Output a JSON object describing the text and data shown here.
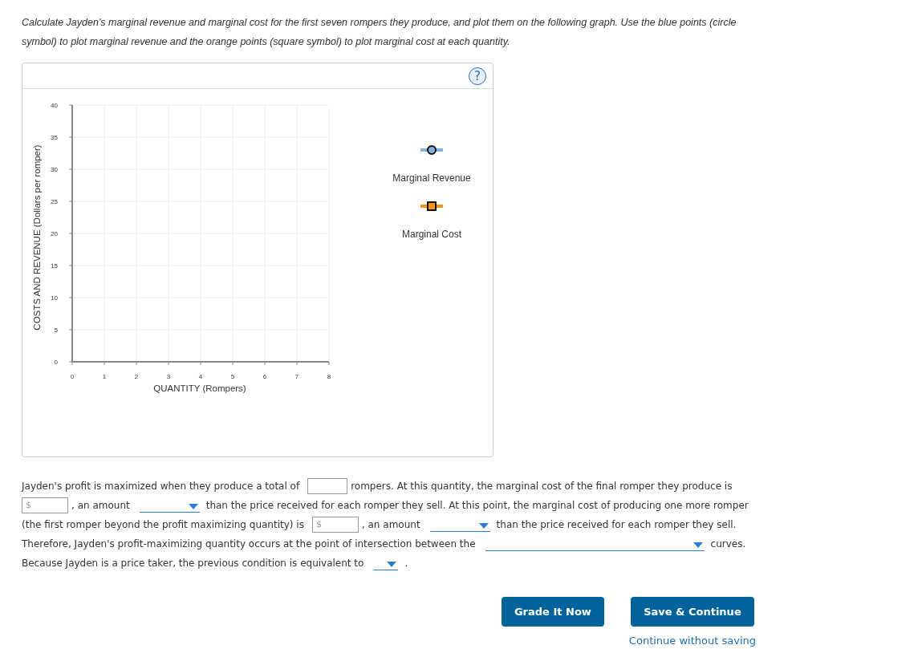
{
  "instructions": "Calculate Jayden's marginal revenue and marginal cost for the first seven rompers they produce, and plot them on the following graph. Use the blue points (circle symbol) to plot marginal revenue and the orange points (square symbol) to plot marginal cost at each quantity.",
  "graph": {
    "help": "?",
    "chart_data": {
      "type": "scatter",
      "grid": true,
      "xlabel": "QUANTITY (Rompers)",
      "ylabel": "COSTS AND REVENUE (Dollars per romper)",
      "xlim": [
        0,
        8
      ],
      "ylim": [
        0,
        40
      ],
      "xticks": [
        0,
        1,
        2,
        3,
        4,
        5,
        6,
        7,
        8
      ],
      "yticks": [
        0,
        5,
        10,
        15,
        20,
        25,
        30,
        35,
        40
      ]
    },
    "legend": [
      {
        "kind": "circle",
        "name": "Marginal Revenue",
        "color": "#7fb2e0"
      },
      {
        "kind": "square",
        "name": "Marginal Cost",
        "color": "#f7931e"
      }
    ]
  },
  "question": [
    [
      {
        "kind": "text",
        "text": "Jayden's profit is maximized when they produce a total of"
      },
      {
        "kind": "field"
      },
      {
        "kind": "text",
        "text": "rompers. At this quantity, the marginal cost of the final romper they produce is"
      }
    ],
    [
      {
        "kind": "field",
        "prefix": "$"
      },
      {
        "kind": "text",
        "text": ", an amount"
      },
      {
        "kind": "dropdown"
      },
      {
        "kind": "text",
        "text": "than the price received for each romper they sell. At this point, the marginal cost of producing one more romper"
      }
    ],
    [
      {
        "kind": "text",
        "text": "(the first romper beyond the profit maximizing quantity) is"
      },
      {
        "kind": "field",
        "prefix": "$"
      },
      {
        "kind": "text",
        "text": ", an amount"
      },
      {
        "kind": "dropdown"
      },
      {
        "kind": "text",
        "text": "than the price received for each romper they sell."
      }
    ],
    [
      {
        "kind": "text",
        "text": "Therefore, Jayden's profit-maximizing quantity occurs at the point of intersection between the"
      },
      {
        "kind": "dropdown"
      },
      {
        "kind": "text",
        "text": "curves."
      }
    ],
    [
      {
        "kind": "text",
        "text": "Because Jayden is a price taker, the previous condition is equivalent to"
      },
      {
        "kind": "dropdown"
      },
      {
        "kind": "text",
        "text": "."
      }
    ]
  ],
  "buttons": [
    "Grade It Now",
    "Save & Continue"
  ],
  "link": "Continue without saving"
}
